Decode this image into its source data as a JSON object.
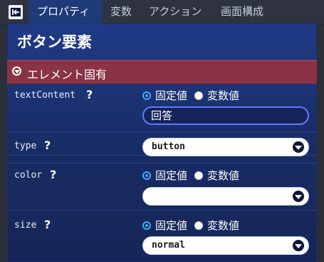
{
  "tabs": [
    {
      "label": "プロパティ"
    },
    {
      "label": "変数"
    },
    {
      "label": "アクション"
    },
    {
      "label": "画面構成"
    }
  ],
  "panel": {
    "title": "ボタン要素",
    "section": {
      "label": "エレメント固有"
    }
  },
  "fields": {
    "textContent": {
      "label": "textContent",
      "help": "?",
      "radio_fixed": "固定値",
      "radio_variable": "変数値",
      "selected": "固定値",
      "value": "回答"
    },
    "type": {
      "label": "type",
      "help": "?",
      "value": "button"
    },
    "color": {
      "label": "color",
      "help": "?",
      "radio_fixed": "固定値",
      "radio_variable": "変数値",
      "selected": "固定値",
      "value": ""
    },
    "size": {
      "label": "size",
      "help": "?",
      "radio_fixed": "固定値",
      "radio_variable": "変数値",
      "selected": "固定値",
      "value": "normal"
    }
  },
  "colors": {
    "accent": "#3fa9ff",
    "section_bar": "#8a3346",
    "panel": "#1f3a82"
  }
}
